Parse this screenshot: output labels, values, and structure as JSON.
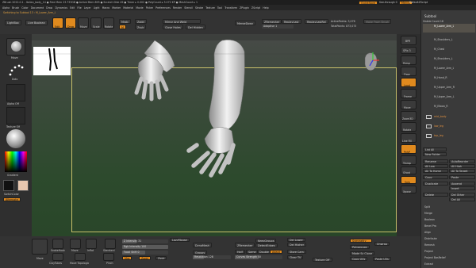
{
  "menubar": {
    "app_title": "ZBrush 2022.0.1 - Italian_body_14  ● Free Mem 23.733GB ● Active Mem 895 ● Scratch Disk 49 ● Timer ▸ 0.002 ● PolyCount ▸ 3.072 KP ● MeshCount ▸ 1",
    "right_items": [
      "QuickSave",
      "See-through 0",
      "Menus",
      "DefaultZScript"
    ],
    "menus": [
      "Alpha",
      "Brush",
      "Color",
      "Document",
      "Draw",
      "Dynamics",
      "Edit",
      "File",
      "Layer",
      "Light",
      "Macro",
      "Marker",
      "Material",
      "Movie",
      "Picker",
      "Preferences",
      "Render",
      "Stencil",
      "Stroke",
      "Texture",
      "Tool",
      "Transform",
      "ZPlugin",
      "ZScript",
      "Help"
    ]
  },
  "shelf": {
    "switching": "Switching to Subtool 13 : M_Lower_Arm_L",
    "lightbox": "LightBox",
    "live_boolean": "Live Boolean",
    "edit": "Edit",
    "draw": "Draw",
    "move": "Move",
    "scale": "Scale",
    "rotate": "Rotate",
    "mrgb": "Mrgb",
    "rgb": "Rgb",
    "m": "M",
    "zadd": "Zadd",
    "zsub": "Zsub",
    "zcut": "Zcut",
    "mirror_weld": "Mirror And Weld",
    "close_holes": "Close Holes",
    "del_hidden": "Del Hidden",
    "merge_down": "MergeDown",
    "split_hidden": "Split Hidden",
    "zremesher": "ZRemesher",
    "adaptive": "Adaptive 1",
    "replay_last": "ReplayLast",
    "replay_last_rel": "ReplayLastRel",
    "active_points": "ActivePoints: 3,076",
    "total_points": "TotalPoints: 873,073",
    "from_brush": "Make From Brush"
  },
  "left_tray": {
    "move_brush": "Move",
    "dots": "Dots",
    "alpha": "Alpha Off",
    "texture": "Texture Off",
    "material": "",
    "gradient": "Gradient",
    "switch_color": "SwitchColor",
    "alternate": "Alternate"
  },
  "right_tray": {
    "labels": [
      "BPR",
      "SPix 3",
      "Persp",
      "Floor",
      "Local",
      "Frame",
      "Move",
      "Zoom3D",
      "Rotate",
      "Line Fill",
      "PolyF",
      "Transp",
      "Ghost",
      "Solo",
      "Xpose"
    ],
    "subtool_header": "Subtool",
    "visible_count": "Visible Count 18",
    "subtools": [
      {
        "name": "M_Lower_Arm_L",
        "sel": true
      },
      {
        "name": "M_Shoulders_L",
        "sel": false
      },
      {
        "name": "M_Chest",
        "sel": false
      },
      {
        "name": "M_Shoulders_L",
        "sel": false
      },
      {
        "name": "M_Lower_Arm_L",
        "sel": false
      },
      {
        "name": "M_Hand_R",
        "sel": false
      },
      {
        "name": "M_Upper_Arm_R",
        "sel": false
      },
      {
        "name": "M_Upper_Arm_L",
        "sel": false
      },
      {
        "name": "M_Elbow_R",
        "sel": false
      }
    ],
    "folders": [
      "mid_body",
      "low_leg",
      "top_leg"
    ],
    "list_all": "List All",
    "new_folder": "New Folder",
    "actions": [
      [
        "Rename",
        "AutoReorder"
      ],
      [
        "All Low",
        "All High"
      ],
      [
        "All To Home",
        "All To Target"
      ],
      [
        "Copy",
        "Paste"
      ],
      [
        "Duplicate",
        "Append"
      ],
      [
        "",
        "Insert"
      ],
      [
        "Delete",
        "Del Other"
      ],
      [
        "",
        "Del All"
      ]
    ],
    "menu_items": [
      "Split",
      "Merge",
      "Boolean",
      "Bevel Pro",
      "Align",
      "Distribute",
      "Remesh",
      "Project",
      "Project BasRelief",
      "Extract"
    ]
  },
  "bottom": {
    "brushes": [
      "Move",
      "SnakeHook",
      "Move",
      "Inflat",
      "Standard",
      "ClayTubes",
      "Move Topologic",
      "Pinch"
    ],
    "z_intensity": "Z Intensity 31",
    "rgb_intensity": "Rgb Intensity 100",
    "focal_shift": "Focal Shift 0",
    "draw_size": "Draw Size 64",
    "z_intensity_frac": 0.31,
    "rgb_intensity_frac": 1.0,
    "focal_shift_frac": 0.5,
    "draw_size_frac": 0.06,
    "lazy_mouse": "LazyMouse",
    "dyna_mesh": "DynaMesh",
    "groups": "Groups",
    "resolution": "Resolution 128",
    "resolution_frac": 0.3,
    "zremesher": "ZRemesher",
    "keep_groups": "KeepGroups",
    "detect_edges": "DetectEdges",
    "half": "Half",
    "same": "Same",
    "double": "Double",
    "adapt": "Adapt",
    "curves_strength": "Curves Strength 50",
    "curves_frac": 0.5,
    "use_poly": "Use Poly",
    "sdiv": "SDiv",
    "del_higher": "Del Higher",
    "del_lower": "Del Lower",
    "store_cam": "Store Cam",
    "clear_ss": "Clear TV",
    "transpose_uv": "Texture Off",
    "symmetry": "Symmetry",
    "polygroups": "Polygroups",
    "mode_x": "Mode Sc Clone",
    "copy_uvs": "Copy UVs",
    "paste_uvs": "Paste UVs",
    "unwrap": "Unwrap",
    "mrg": "Mrg",
    "zadd": "Zadd",
    "zsub": "Zsub"
  }
}
